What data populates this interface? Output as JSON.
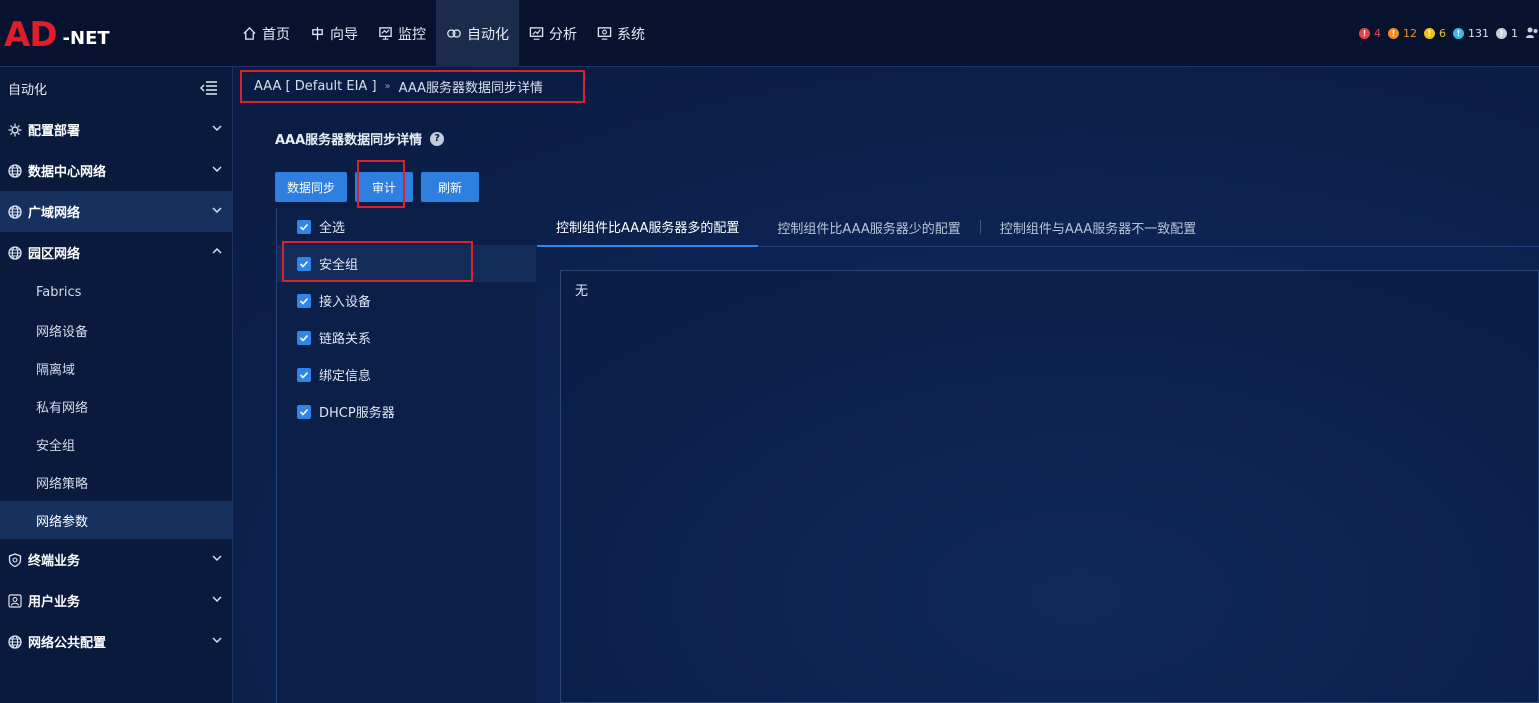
{
  "logo": {
    "main": "AD",
    "suffix": "-NET"
  },
  "nav": [
    {
      "label": "首页",
      "icon": "home-icon"
    },
    {
      "label": "向导",
      "icon": "guide-icon"
    },
    {
      "label": "监控",
      "icon": "monitor-icon"
    },
    {
      "label": "自动化",
      "icon": "automation-icon",
      "active": true
    },
    {
      "label": "分析",
      "icon": "analysis-icon"
    },
    {
      "label": "系统",
      "icon": "system-icon"
    }
  ],
  "alerts": [
    {
      "count": "4",
      "color": "#e8414e"
    },
    {
      "count": "12",
      "color": "#f08a24"
    },
    {
      "count": "6",
      "color": "#f2c21a"
    },
    {
      "count": "131",
      "color": "#3fb6e8"
    },
    {
      "count": "1",
      "color": "#c9cfd9"
    }
  ],
  "sidebar": {
    "title": "自动化",
    "groups": [
      {
        "label": "配置部署",
        "icon": "config-icon"
      },
      {
        "label": "数据中心网络",
        "icon": "globe-icon"
      },
      {
        "label": "广域网络",
        "icon": "globe-icon"
      },
      {
        "label": "园区网络",
        "icon": "globe-icon"
      }
    ],
    "subs": [
      "Fabrics",
      "网络设备",
      "隔离域",
      "私有网络",
      "安全组",
      "网络策略",
      "网络参数"
    ],
    "groups_after": [
      {
        "label": "终端业务",
        "icon": "shield-icon"
      },
      {
        "label": "用户业务",
        "icon": "user-icon"
      },
      {
        "label": "网络公共配置",
        "icon": "globe-icon"
      }
    ]
  },
  "breadcrumb": {
    "root": "AAA [ Default EIA ]",
    "sep": "»",
    "current": "AAA服务器数据同步详情"
  },
  "page": {
    "title": "AAA服务器数据同步详情",
    "help": "?"
  },
  "buttons": {
    "sync": "数据同步",
    "audit": "审计",
    "refresh": "刷新"
  },
  "checks": [
    {
      "label": "全选",
      "checked": true
    },
    {
      "label": "安全组",
      "checked": true
    },
    {
      "label": "接入设备",
      "checked": true
    },
    {
      "label": "链路关系",
      "checked": true
    },
    {
      "label": "绑定信息",
      "checked": true
    },
    {
      "label": "DHCP服务器",
      "checked": true
    }
  ],
  "tabs": [
    {
      "label": "控制组件比AAA服务器多的配置",
      "active": true
    },
    {
      "label": "控制组件比AAA服务器少的配置"
    },
    {
      "label": "控制组件与AAA服务器不一致配置"
    }
  ],
  "content": {
    "empty_text": "无"
  }
}
